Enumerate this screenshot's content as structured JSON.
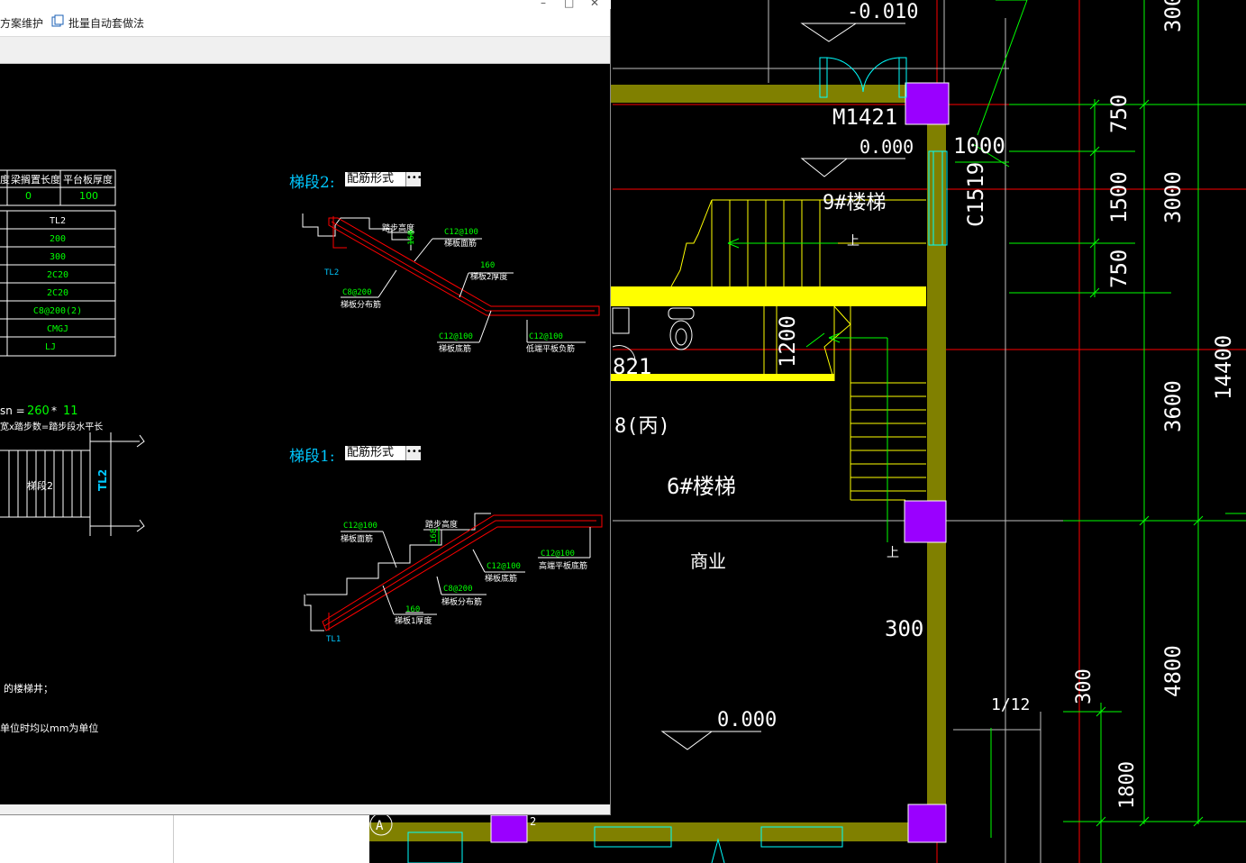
{
  "toolbar": {
    "scheme_maintain_label": "方案维护",
    "batch_auto_label": "批量自动套做法"
  },
  "cad_main": {
    "elevation_top": "-0.010",
    "door_label": "M1421",
    "elevation_mid": "0.000",
    "stair9_label": "9#楼梯",
    "window_label": "C1519",
    "dim_1000": "1000",
    "dim_750a": "750",
    "dim_1500": "1500",
    "dim_750b": "750",
    "dim_3000": "3000",
    "dim_300top": "300",
    "dim_1200": "1200",
    "partial_821": "821",
    "partial_8bing": "8(丙)",
    "stair6_label": "6#楼梯",
    "shop_label": "商业",
    "dim_300": "300",
    "dim_3600": "3600",
    "dim_14400": "14400",
    "dim_4800": "4800",
    "dim_300b": "300",
    "dim_1800": "1800",
    "slope_label": "1/12",
    "elevation_bottom": "0.000",
    "axis_a": "A",
    "up_mark1": "上",
    "up_mark2": "上",
    "partial_2": "2"
  },
  "table1": {
    "headers": [
      "度",
      "梁搁置长度",
      "平台板厚度"
    ],
    "row": [
      "",
      "0",
      "100"
    ]
  },
  "table2": {
    "values": [
      "TL2",
      "200",
      "300",
      "2C20",
      "2C20",
      "C8@200(2)",
      "CMGJ",
      "LJ"
    ]
  },
  "formula": {
    "prefix": "sn =",
    "value1": "260",
    "times": "*",
    "value2": "11",
    "note": "宽x踏步数=踏步段水平长"
  },
  "plan": {
    "stair_label": "梯段2",
    "beam_label": "TL2"
  },
  "notes": {
    "line1": "的楼梯井；",
    "line2": "单位时均以mm为单位"
  },
  "segment2": {
    "title": "梯段2:",
    "combo": "配筋形式",
    "step_height": "踏步高度",
    "step_value": "168",
    "top_bar": "C12@100",
    "top_bar_name": "梯板面筋",
    "thickness": "160",
    "thickness_name": "梯板2厚度",
    "dist_bar": "C8@200",
    "dist_bar_name": "梯板分布筋",
    "bottom_bar": "C12@100",
    "bottom_bar_name": "梯板底筋",
    "neg_bar": "C12@100",
    "neg_bar_name": "低端平板负筋",
    "beam": "TL2"
  },
  "segment1": {
    "title": "梯段1:",
    "combo": "配筋形式",
    "top_bar": "C12@100",
    "top_bar_name": "梯板面筋",
    "step_height": "踏步高度",
    "step_value": "168",
    "high_bar": "C12@100",
    "high_bar_name": "高端平板底筋",
    "bottom_bar": "C12@100",
    "bottom_bar_name": "梯板底筋",
    "dist_bar": "C8@200",
    "dist_bar_name": "梯板分布筋",
    "thickness": "160",
    "thickness_name": "梯板1厚度",
    "beam": "TL1"
  },
  "colors": {
    "wall": "#808000",
    "column": "#9a00ff",
    "stair": "#ffff00",
    "dim": "#00ff00",
    "axis": "#ff0000",
    "window": "#00ffff",
    "text": "#ffffff",
    "rebar": "#ff0000",
    "label_cyan": "#00c8ff"
  }
}
